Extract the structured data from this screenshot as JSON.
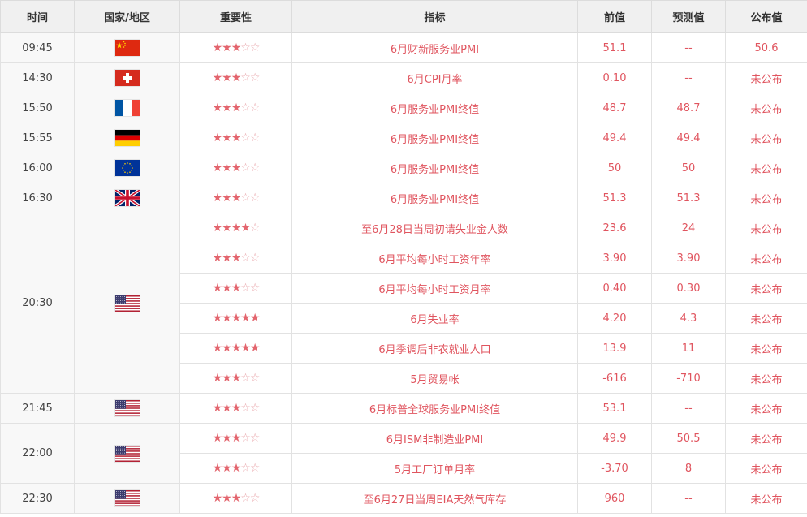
{
  "header": {
    "time": "时间",
    "country": "国家/地区",
    "importance": "重要性",
    "indicator": "指标",
    "previous": "前值",
    "forecast": "预测值",
    "actual": "公布值"
  },
  "colors": {
    "accent": "#e0555f",
    "header_bg": "#f0f0f0",
    "border": "#e2e2e2"
  },
  "rows": [
    {
      "time": "09:45",
      "country": "china",
      "stars": 3,
      "indicator": "6月财新服务业PMI",
      "previous": "51.1",
      "forecast": "--",
      "actual": "50.6"
    },
    {
      "time": "14:30",
      "country": "switzerland",
      "stars": 3,
      "indicator": "6月CPI月率",
      "previous": "0.10",
      "forecast": "--",
      "actual": "未公布"
    },
    {
      "time": "15:50",
      "country": "france",
      "stars": 3,
      "indicator": "6月服务业PMI终值",
      "previous": "48.7",
      "forecast": "48.7",
      "actual": "未公布"
    },
    {
      "time": "15:55",
      "country": "germany",
      "stars": 3,
      "indicator": "6月服务业PMI终值",
      "previous": "49.4",
      "forecast": "49.4",
      "actual": "未公布"
    },
    {
      "time": "16:00",
      "country": "eurozone",
      "stars": 3,
      "indicator": "6月服务业PMI终值",
      "previous": "50",
      "forecast": "50",
      "actual": "未公布"
    },
    {
      "time": "16:30",
      "country": "uk",
      "stars": 3,
      "indicator": "6月服务业PMI终值",
      "previous": "51.3",
      "forecast": "51.3",
      "actual": "未公布"
    },
    {
      "time": "20:30",
      "country": "usa",
      "stars": 4,
      "indicator": "至6月28日当周初请失业金人数",
      "previous": "23.6",
      "forecast": "24",
      "actual": "未公布",
      "group_span": 6
    },
    {
      "stars": 3,
      "indicator": "6月平均每小时工资年率",
      "previous": "3.90",
      "forecast": "3.90",
      "actual": "未公布"
    },
    {
      "stars": 3,
      "indicator": "6月平均每小时工资月率",
      "previous": "0.40",
      "forecast": "0.30",
      "actual": "未公布"
    },
    {
      "stars": 5,
      "indicator": "6月失业率",
      "previous": "4.20",
      "forecast": "4.3",
      "actual": "未公布"
    },
    {
      "stars": 5,
      "indicator": "6月季调后非农就业人口",
      "previous": "13.9",
      "forecast": "11",
      "actual": "未公布"
    },
    {
      "stars": 3,
      "indicator": "5月贸易帐",
      "previous": "-616",
      "forecast": "-710",
      "actual": "未公布"
    },
    {
      "time": "21:45",
      "country": "usa",
      "stars": 3,
      "indicator": "6月标普全球服务业PMI终值",
      "previous": "53.1",
      "forecast": "--",
      "actual": "未公布"
    },
    {
      "time": "22:00",
      "country": "usa",
      "stars": 3,
      "indicator": "6月ISM非制造业PMI",
      "previous": "49.9",
      "forecast": "50.5",
      "actual": "未公布",
      "group_span": 2
    },
    {
      "stars": 3,
      "indicator": "5月工厂订单月率",
      "previous": "-3.70",
      "forecast": "8",
      "actual": "未公布"
    },
    {
      "time": "22:30",
      "country": "usa",
      "stars": 3,
      "indicator": "至6月27日当周EIA天然气库存",
      "previous": "960",
      "forecast": "--",
      "actual": "未公布"
    }
  ]
}
